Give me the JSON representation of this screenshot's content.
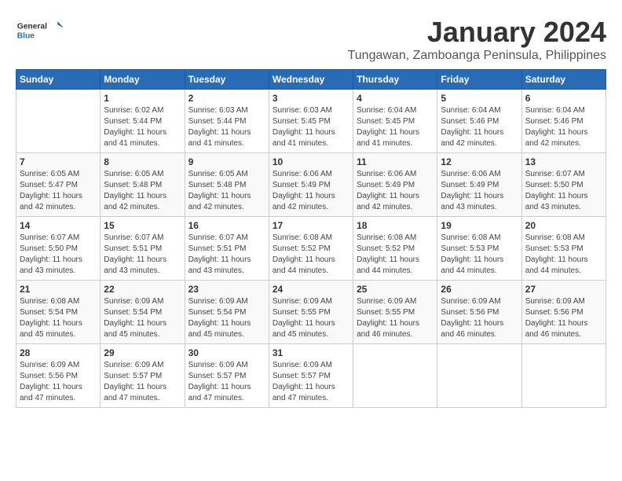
{
  "logo": {
    "general": "General",
    "blue": "Blue"
  },
  "title": "January 2024",
  "location": "Tungawan, Zamboanga Peninsula, Philippines",
  "headers": [
    "Sunday",
    "Monday",
    "Tuesday",
    "Wednesday",
    "Thursday",
    "Friday",
    "Saturday"
  ],
  "weeks": [
    [
      {
        "day": "",
        "sunrise": "",
        "sunset": "",
        "daylight": ""
      },
      {
        "day": "1",
        "sunrise": "6:02 AM",
        "sunset": "5:44 PM",
        "daylight": "11 hours and 41 minutes."
      },
      {
        "day": "2",
        "sunrise": "6:03 AM",
        "sunset": "5:44 PM",
        "daylight": "11 hours and 41 minutes."
      },
      {
        "day": "3",
        "sunrise": "6:03 AM",
        "sunset": "5:45 PM",
        "daylight": "11 hours and 41 minutes."
      },
      {
        "day": "4",
        "sunrise": "6:04 AM",
        "sunset": "5:45 PM",
        "daylight": "11 hours and 41 minutes."
      },
      {
        "day": "5",
        "sunrise": "6:04 AM",
        "sunset": "5:46 PM",
        "daylight": "11 hours and 42 minutes."
      },
      {
        "day": "6",
        "sunrise": "6:04 AM",
        "sunset": "5:46 PM",
        "daylight": "11 hours and 42 minutes."
      }
    ],
    [
      {
        "day": "7",
        "sunrise": "6:05 AM",
        "sunset": "5:47 PM",
        "daylight": "11 hours and 42 minutes."
      },
      {
        "day": "8",
        "sunrise": "6:05 AM",
        "sunset": "5:48 PM",
        "daylight": "11 hours and 42 minutes."
      },
      {
        "day": "9",
        "sunrise": "6:05 AM",
        "sunset": "5:48 PM",
        "daylight": "11 hours and 42 minutes."
      },
      {
        "day": "10",
        "sunrise": "6:06 AM",
        "sunset": "5:49 PM",
        "daylight": "11 hours and 42 minutes."
      },
      {
        "day": "11",
        "sunrise": "6:06 AM",
        "sunset": "5:49 PM",
        "daylight": "11 hours and 42 minutes."
      },
      {
        "day": "12",
        "sunrise": "6:06 AM",
        "sunset": "5:49 PM",
        "daylight": "11 hours and 43 minutes."
      },
      {
        "day": "13",
        "sunrise": "6:07 AM",
        "sunset": "5:50 PM",
        "daylight": "11 hours and 43 minutes."
      }
    ],
    [
      {
        "day": "14",
        "sunrise": "6:07 AM",
        "sunset": "5:50 PM",
        "daylight": "11 hours and 43 minutes."
      },
      {
        "day": "15",
        "sunrise": "6:07 AM",
        "sunset": "5:51 PM",
        "daylight": "11 hours and 43 minutes."
      },
      {
        "day": "16",
        "sunrise": "6:07 AM",
        "sunset": "5:51 PM",
        "daylight": "11 hours and 43 minutes."
      },
      {
        "day": "17",
        "sunrise": "6:08 AM",
        "sunset": "5:52 PM",
        "daylight": "11 hours and 44 minutes."
      },
      {
        "day": "18",
        "sunrise": "6:08 AM",
        "sunset": "5:52 PM",
        "daylight": "11 hours and 44 minutes."
      },
      {
        "day": "19",
        "sunrise": "6:08 AM",
        "sunset": "5:53 PM",
        "daylight": "11 hours and 44 minutes."
      },
      {
        "day": "20",
        "sunrise": "6:08 AM",
        "sunset": "5:53 PM",
        "daylight": "11 hours and 44 minutes."
      }
    ],
    [
      {
        "day": "21",
        "sunrise": "6:08 AM",
        "sunset": "5:54 PM",
        "daylight": "11 hours and 45 minutes."
      },
      {
        "day": "22",
        "sunrise": "6:09 AM",
        "sunset": "5:54 PM",
        "daylight": "11 hours and 45 minutes."
      },
      {
        "day": "23",
        "sunrise": "6:09 AM",
        "sunset": "5:54 PM",
        "daylight": "11 hours and 45 minutes."
      },
      {
        "day": "24",
        "sunrise": "6:09 AM",
        "sunset": "5:55 PM",
        "daylight": "11 hours and 45 minutes."
      },
      {
        "day": "25",
        "sunrise": "6:09 AM",
        "sunset": "5:55 PM",
        "daylight": "11 hours and 46 minutes."
      },
      {
        "day": "26",
        "sunrise": "6:09 AM",
        "sunset": "5:56 PM",
        "daylight": "11 hours and 46 minutes."
      },
      {
        "day": "27",
        "sunrise": "6:09 AM",
        "sunset": "5:56 PM",
        "daylight": "11 hours and 46 minutes."
      }
    ],
    [
      {
        "day": "28",
        "sunrise": "6:09 AM",
        "sunset": "5:56 PM",
        "daylight": "11 hours and 47 minutes."
      },
      {
        "day": "29",
        "sunrise": "6:09 AM",
        "sunset": "5:57 PM",
        "daylight": "11 hours and 47 minutes."
      },
      {
        "day": "30",
        "sunrise": "6:09 AM",
        "sunset": "5:57 PM",
        "daylight": "11 hours and 47 minutes."
      },
      {
        "day": "31",
        "sunrise": "6:09 AM",
        "sunset": "5:57 PM",
        "daylight": "11 hours and 47 minutes."
      },
      {
        "day": "",
        "sunrise": "",
        "sunset": "",
        "daylight": ""
      },
      {
        "day": "",
        "sunrise": "",
        "sunset": "",
        "daylight": ""
      },
      {
        "day": "",
        "sunrise": "",
        "sunset": "",
        "daylight": ""
      }
    ]
  ],
  "labels": {
    "sunrise": "Sunrise:",
    "sunset": "Sunset:",
    "daylight": "Daylight:"
  }
}
